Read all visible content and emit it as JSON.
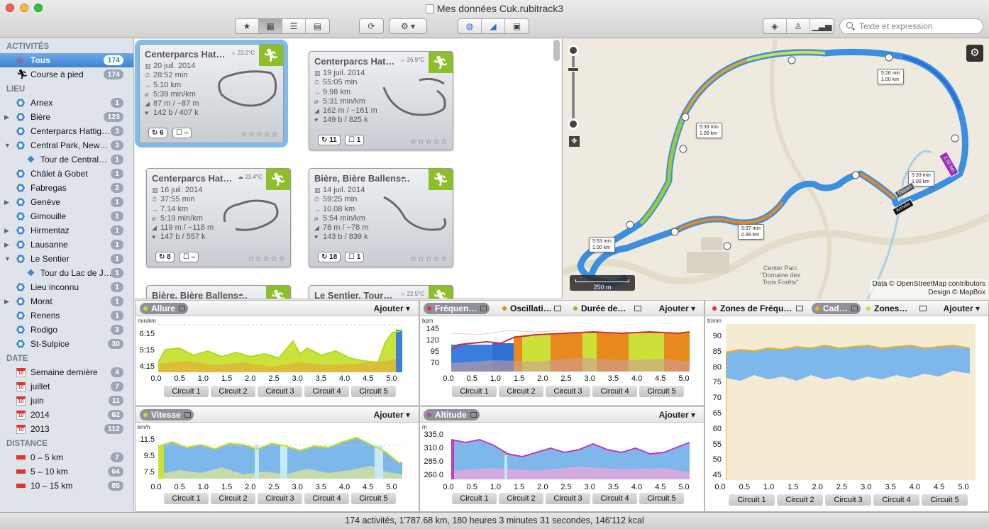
{
  "window": {
    "title": "Mes données Cuk.rubitrack3",
    "search_placeholder": "Texte et expression"
  },
  "colors": {
    "selection": "#3d82d3",
    "run_badge": "#8dbf2a",
    "route_blue": "#3a8fe0",
    "route_green": "#9acd32",
    "route_orange": "#e8891e"
  },
  "sidebar": {
    "activities_header": "ACTIVITÉS",
    "activities": [
      {
        "label": "Tous",
        "count": "174",
        "icon": "target-icon"
      },
      {
        "label": "Course à pied",
        "count": "174",
        "icon": "runner-icon"
      }
    ],
    "places_header": "LIEU",
    "places": [
      {
        "label": "Arnex",
        "count": "1"
      },
      {
        "label": "Bière",
        "count": "123"
      },
      {
        "label": "Centerparcs Hattig…",
        "count": "3"
      },
      {
        "label": "Central Park, New…",
        "count": "3"
      },
      {
        "label": "Tour de Central…",
        "count": "1"
      },
      {
        "label": "Châlet à Gobet",
        "count": "1"
      },
      {
        "label": "Fabregas",
        "count": "2"
      },
      {
        "label": "Genève",
        "count": "1"
      },
      {
        "label": "Gimouille",
        "count": "1"
      },
      {
        "label": "Hirmentaz",
        "count": "1"
      },
      {
        "label": "Lausanne",
        "count": "1"
      },
      {
        "label": "Le Sentier",
        "count": "1"
      },
      {
        "label": "Tour du Lac de J…",
        "count": "1"
      },
      {
        "label": "Lieu inconnu",
        "count": "1"
      },
      {
        "label": "Morat",
        "count": "1"
      },
      {
        "label": "Renens",
        "count": "1"
      },
      {
        "label": "Rodigo",
        "count": "3"
      },
      {
        "label": "St-Sulpice",
        "count": "30"
      }
    ],
    "date_header": "DATE",
    "dates": [
      {
        "label": "Semaine dernière",
        "count": "4"
      },
      {
        "label": "juillet",
        "count": "7"
      },
      {
        "label": "juin",
        "count": "11"
      },
      {
        "label": "2014",
        "count": "62"
      },
      {
        "label": "2013",
        "count": "112"
      }
    ],
    "distance_header": "DISTANCE",
    "distances": [
      {
        "label": "0 – 5 km",
        "count": "7"
      },
      {
        "label": "5 – 10 km",
        "count": "64"
      },
      {
        "label": "10 – 15 km",
        "count": "85"
      }
    ]
  },
  "cards": [
    {
      "title": "Centerparcs Hat…",
      "temp": "23.2°C",
      "date": "20 juil. 2014",
      "duration": "28:52 min",
      "distance": "5.10 km",
      "pace": "5:39 min/km",
      "elev": "87 m / −87 m",
      "hr": "142 b / 407 k",
      "laps": "6",
      "notes": "–"
    },
    {
      "title": "Centerparcs Hat…",
      "temp": "26.9°C",
      "date": "19 juil. 2014",
      "duration": "55:05 min",
      "distance": "9.98 km",
      "pace": "5:31 min/km",
      "elev": "162 m / −161 m",
      "hr": "149 b / 825 k",
      "laps": "11",
      "notes": "1"
    },
    {
      "title": "Centerparcs Hat…",
      "temp": "23.4°C",
      "date": "16 juil. 2014",
      "duration": "37:55 min",
      "distance": "7.14 km",
      "pace": "5:19 min/km",
      "elev": "119 m / −118 m",
      "hr": "147 b / 557 k",
      "laps": "8",
      "notes": "–"
    },
    {
      "title": "Bière, Bière Ballens…",
      "temp": "",
      "date": "14 juil. 2014",
      "duration": "59:25 min",
      "distance": "10.08 km",
      "pace": "5:54 min/km",
      "elev": "78 m / −78 m",
      "hr": "143 b / 839 k",
      "laps": "18",
      "notes": "1"
    },
    {
      "title": "Bière, Bière Ballens…",
      "temp": ""
    },
    {
      "title": "Le Sentier, Tour…",
      "temp": "22.5°C"
    }
  ],
  "map": {
    "attribution": "Data © OpenStreetMap contributors",
    "design": "Design © MapBox",
    "scale": "250 m",
    "place": "Center Parc \"Domaine des Trois Forêts\"",
    "depart": "Départ",
    "arrivee": "Arrivée",
    "km_badge": "2.50 km",
    "splits": [
      {
        "time": "5:26 min",
        "dist": "1.00 km"
      },
      {
        "time": "5:33 min",
        "dist": "1.00 km"
      },
      {
        "time": "5:33 min",
        "dist": "1.00 km"
      },
      {
        "time": "5:37 min",
        "dist": "0.99 km"
      },
      {
        "time": "5:53 min",
        "dist": "1.00 km"
      }
    ]
  },
  "panels": {
    "add_label": "Ajouter",
    "circuits": [
      "Circuit 1",
      "Circuit 2",
      "Circuit 3",
      "Circuit 4",
      "Circuit 5"
    ],
    "x_ticks": [
      "0.0",
      "0.5",
      "1.0",
      "1.5",
      "2.0",
      "2.5",
      "3.0",
      "3.5",
      "4.0",
      "4.5",
      "5.0"
    ],
    "allure": {
      "label": "Allure",
      "unit": "min/km",
      "yticks": [
        "6:15",
        "5:15",
        "4:15"
      ]
    },
    "vitesse": {
      "label": "Vitesse",
      "unit": "km/h",
      "yticks": [
        "11.5",
        "9.5",
        "7.5"
      ]
    },
    "freq": {
      "label": "Fréquen…",
      "other1": "Oscillati…",
      "other2": "Durée de…",
      "unit": "bpm",
      "yticks": [
        "145",
        "120",
        "95",
        "70"
      ]
    },
    "altitude": {
      "label": "Altitude",
      "unit": "m",
      "yticks": [
        "335.0",
        "310.0",
        "285.0",
        "260.0"
      ]
    },
    "cadence": {
      "zones": "Zones de Fréqu…",
      "label": "Cad…",
      "zones2": "Zones…",
      "unit": "tr/min",
      "yticks": [
        "90",
        "85",
        "80",
        "75",
        "70",
        "65",
        "60",
        "55",
        "50",
        "45"
      ]
    }
  },
  "status": "174 activités, 1'787.68 km, 180 heures 3 minutes 31 secondes, 146'112 kcal"
}
